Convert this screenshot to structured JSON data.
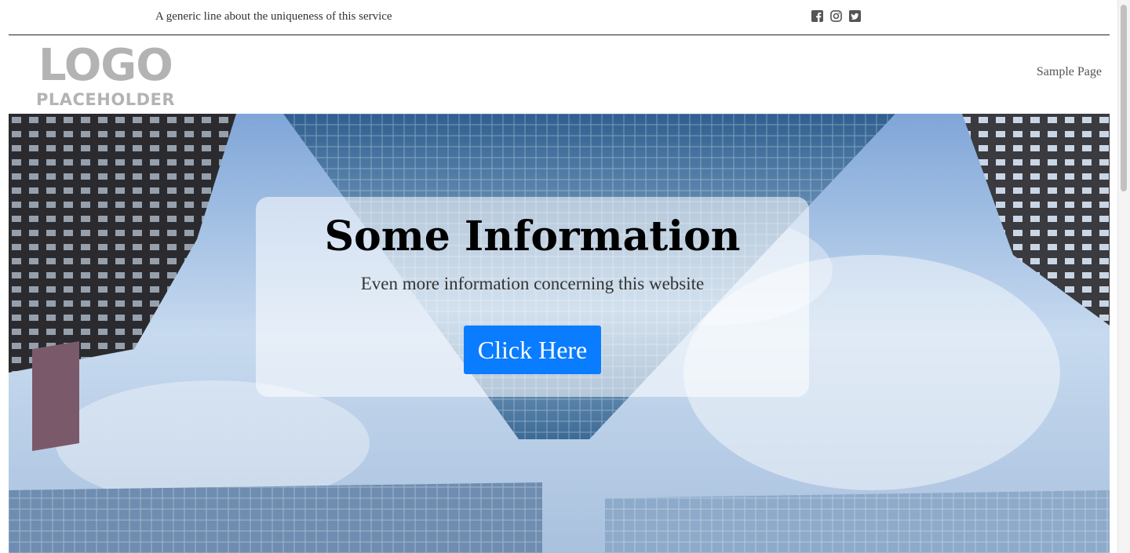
{
  "topbar": {
    "tagline": "A generic line about the uniqueness of this service",
    "social_icons": [
      "facebook-icon",
      "instagram-icon",
      "twitter-icon"
    ]
  },
  "header": {
    "logo_line1": "LOGO",
    "logo_line2": "PLACEHOLDER",
    "nav": [
      {
        "label": "Sample Page"
      }
    ]
  },
  "hero": {
    "title": "Some Information",
    "subtitle": "Even more information concerning this website",
    "button_label": "Click Here",
    "button_color": "#0a7cff"
  }
}
